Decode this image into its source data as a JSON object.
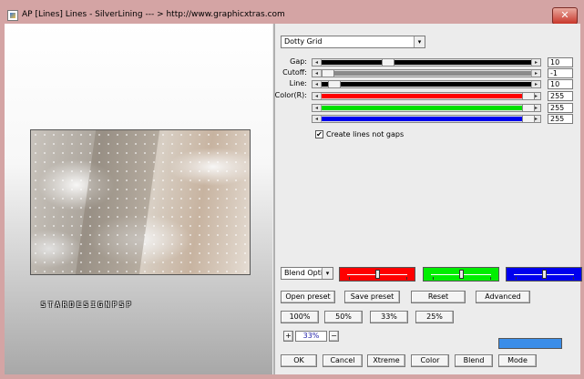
{
  "window": {
    "title": "AP [Lines]  Lines - SilverLining    --- > http://www.graphicxtras.com",
    "close_label": "✕"
  },
  "preview": {
    "watermark": "STARDESIGNPSP"
  },
  "effect": {
    "selected": "Dotty Grid",
    "arrow": "▾"
  },
  "sliders": [
    {
      "label": "Gap:",
      "value": "10",
      "color": "#000000",
      "level": 0.3
    },
    {
      "label": "Cutoff:",
      "value": "-1",
      "color": "#8a8a8a",
      "level": 0.0
    },
    {
      "label": "Line:",
      "value": "10",
      "color": "#000000",
      "level": 0.03
    },
    {
      "label": "Color(R):",
      "value": "255",
      "color": "#ff0000",
      "level": 1.0
    },
    {
      "label": "",
      "value": "255",
      "color": "#00e000",
      "level": 1.0
    },
    {
      "label": "",
      "value": "255",
      "color": "#0000ee",
      "level": 1.0
    }
  ],
  "checkbox": {
    "label": "Create lines not gaps",
    "checked": true,
    "mark": "✔"
  },
  "blend": {
    "selected": "Blend Optio",
    "arrow": "▾",
    "color_sliders": [
      {
        "color": "#ff0000",
        "level": 0.5
      },
      {
        "color": "#00ee00",
        "level": 0.5
      },
      {
        "color": "#0000ee",
        "level": 0.5
      }
    ]
  },
  "buttons": {
    "open_preset": "Open preset",
    "save_preset": "Save preset",
    "reset": "Reset",
    "advanced": "Advanced",
    "zoom_100": "100%",
    "zoom_50": "50%",
    "zoom_33": "33%",
    "zoom_25": "25%",
    "zoom_plus": "+",
    "zoom_minus": "−",
    "zoom_value": "33%",
    "ok": "OK",
    "cancel": "Cancel",
    "xtreme": "Xtreme",
    "color": "Color",
    "blend": "Blend",
    "mode": "Mode"
  },
  "swatch_color": "#3a8de8"
}
